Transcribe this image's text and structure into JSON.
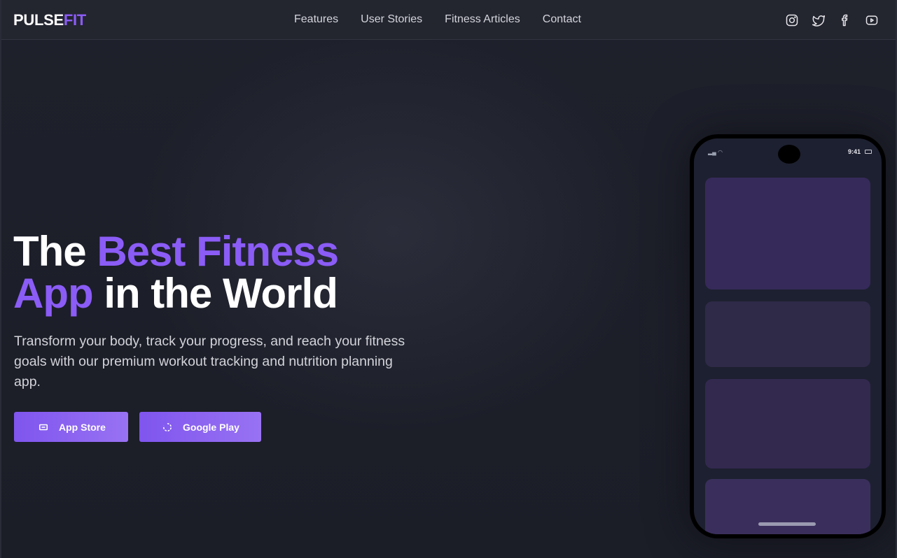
{
  "brand": {
    "name_part1": "PULSE",
    "name_part2": "FIT",
    "accent_color": "#8b5cf6"
  },
  "nav": {
    "links": [
      "Features",
      "User Stories",
      "Fitness Articles",
      "Contact"
    ]
  },
  "social": [
    "instagram-icon",
    "twitter-icon",
    "facebook-icon",
    "youtube-icon"
  ],
  "hero": {
    "title_word1": "The",
    "title_accent1": "Best Fitness",
    "title_accent2": "App",
    "title_rest": "in the World",
    "subtitle": "Transform your body, track your progress, and reach your fitness goals with our premium workout tracking and nutrition planning app.",
    "buttons": {
      "app_store": "App Store",
      "google_play": "Google Play"
    }
  },
  "phone": {
    "time": "9:41"
  }
}
